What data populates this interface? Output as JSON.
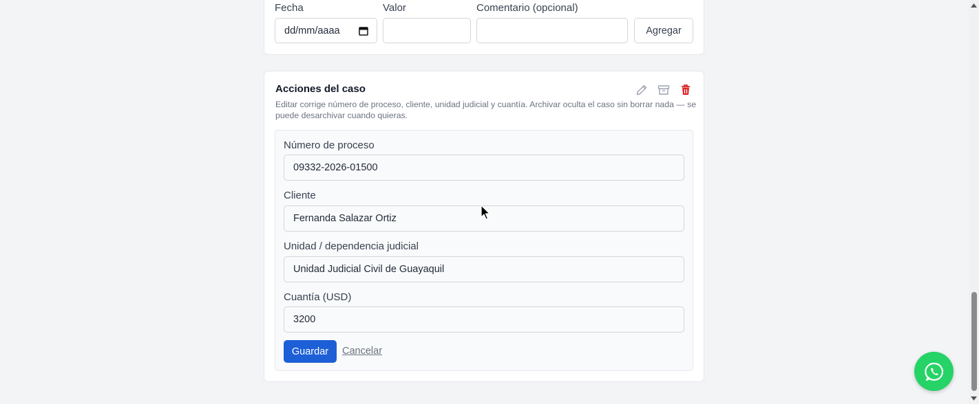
{
  "movement_form": {
    "fecha_label": "Fecha",
    "fecha_placeholder": "dd/mm/aaaa",
    "valor_label": "Valor",
    "comentario_label": "Comentario (opcional)",
    "agregar_label": "Agregar"
  },
  "case_actions": {
    "title": "Acciones del caso",
    "description": "Editar corrige número de proceso, cliente, unidad judicial y cuantía. Archivar oculta el caso sin borrar nada — se puede desarchivar cuando quieras.",
    "icons": [
      "pencil-icon",
      "archive-icon",
      "trash-icon"
    ],
    "form": {
      "numero_label": "Número de proceso",
      "numero_value": "09332-2026-01500",
      "cliente_label": "Cliente",
      "cliente_value": "Fernanda Salazar Ortiz",
      "unidad_label": "Unidad / dependencia judicial",
      "unidad_value": "Unidad Judicial Civil de Guayaquil",
      "cuantia_label": "Cuantía (USD)",
      "cuantia_value": "3200",
      "guardar_label": "Guardar",
      "cancelar_label": "Cancelar"
    }
  },
  "colors": {
    "primary": "#1d5fd6",
    "danger": "#dc2626",
    "whatsapp": "#25d366"
  },
  "floating": {
    "icon": "whatsapp-icon"
  }
}
